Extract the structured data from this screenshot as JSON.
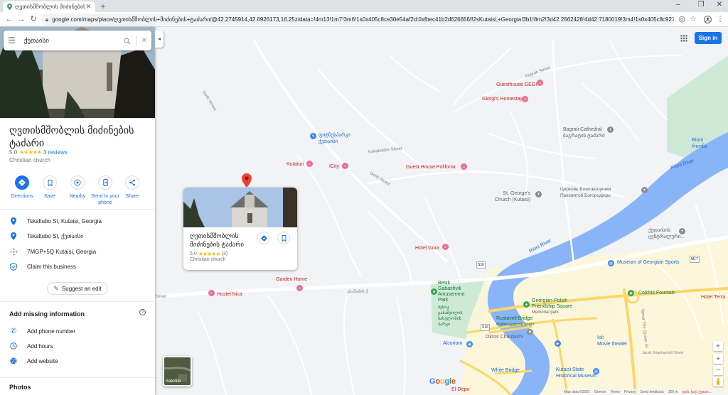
{
  "browser": {
    "tab_title": "ღვთისმშობლის მიძინების ტ",
    "url": "google.com/maps/place/ღვთისმშობლის+მიძინების+ტაძარი/@42.2745914,42.6926173,16.25z/data=!4m13!1m7!3m6!1s0x405c8ce30e54af2d:0xfbec41b2d626656f!2sKutaisi,+Georgia!3b1!8m2!3d42.2662428!4d42.7180019!3m4!1s0x405c8c92767280bf:0xdc0"
  },
  "search": {
    "query": "ქუთაისი"
  },
  "place": {
    "title": "ღვთისმშობლის მიძინების ტაძარი",
    "rating": "5.0",
    "stars": "★★★★★",
    "reviews": "3 reviews",
    "type": "Christian church",
    "actions": [
      {
        "label": "Directions",
        "icon": "directions-icon"
      },
      {
        "label": "Save",
        "icon": "bookmark-icon"
      },
      {
        "label": "Nearby",
        "icon": "nearby-icon"
      },
      {
        "label": "Send to your phone",
        "icon": "phone-icon"
      },
      {
        "label": "Share",
        "icon": "share-icon"
      }
    ],
    "details": [
      {
        "text": "Tskaltubo St, Kutaisi, Georgia",
        "icon": "location-pin-icon"
      },
      {
        "text": "Tskaltubo St, ქუთაისი",
        "icon": "location-pin-icon"
      },
      {
        "text": "7MGP+5Q Kutaisi, Georgia",
        "icon": "plus-code-icon"
      },
      {
        "text": "Claim this business",
        "icon": "verified-shield-icon"
      }
    ],
    "suggest_edit": "Suggest an edit",
    "add_missing": {
      "header": "Add missing information",
      "items": [
        {
          "text": "Add phone number",
          "icon": "phone-call-icon"
        },
        {
          "text": "Add hours",
          "icon": "clock-icon"
        },
        {
          "text": "Add website",
          "icon": "globe-icon"
        }
      ]
    },
    "photos_header": "Photos"
  },
  "map": {
    "signin": "Sign in",
    "card": {
      "title": "ღვთისმშობლის მიძინების ტაძარი",
      "rating": "5.0",
      "stars": "★★★★★",
      "reviews": "(3)",
      "type": "Christian church"
    },
    "satellite_label": "Satellite",
    "google_logo": "Google",
    "footer": {
      "data": "Map data ©2021",
      "country": "Greece",
      "terms": "Terms",
      "privacy": "Privacy",
      "feedback": "Send feedback",
      "scale": "100 m",
      "extra": "დის. საქ. ქუთაი..."
    },
    "pois": {
      "guesthouse_gegi": "Guesthouse GEGI",
      "giorgis_homestay": "Giorgi's Homestay",
      "bagrati": "Bagrati Cathedral",
      "bagrati_ka": "ბაგრატის ტაძარი",
      "rioni": "Rioni",
      "rioni_ka": "რიონი",
      "rioni_river": "Rioni River",
      "rioni_river2": "Rioni River",
      "kutaturi": "Kutaturi",
      "icity": "ICity",
      "guesthouse_polifonia": "Guest House Polifonia",
      "school": "ფიტნესპარკი",
      "school2": "ქუთაისი",
      "st_george": "St. George's Church (Kutaisi)",
      "tserkov": "Церковь Благовещения Пресвятой Богородицы",
      "kutaisi_ka": "ქუთაისის",
      "kutaisi_ka2": "ცენტრალური...",
      "hotel_gora": "Hotel Gora",
      "museum_sports": "Museum of Georgian Sports",
      "besik1": "Besik",
      "besik2": "Gabashvili",
      "besik3": "Amusement",
      "besik4": "Park",
      "besik_ka1": "ბესიკ",
      "besik_ka2": "გაბაშვილის",
      "besik_ka3": "სახელობის",
      "besik_ka4": "პარკი",
      "garden_home": "Garden Home",
      "hostel_nica": "Hostel Nica",
      "georgian_polish1": "Georgian-Polish",
      "georgian_polish2": "Friendship Square",
      "memorial": "Memorial park",
      "colchis": "Colchis Fountain",
      "hotel_terra": "Hotel Terra",
      "rustaveli": "Rustaveli Bridge",
      "rustaveli_ka": "რუსთაველის ხიდი",
      "okros_chardakhi": "Okros Chardakhi",
      "alcorium": "Alcorium",
      "ioli": "Ioli",
      "movie_theater": "Movie theater",
      "white_bridge": "White Bridge",
      "kutaisi_state1": "Kutaisi State",
      "kutaisi_state2": "Historical Museum",
      "el_depo": "El-Depo",
      "street_gorki": "Gorki Street",
      "street_gorki2": "Gorki Street",
      "street_tskaltubo": "Tskaltubo Street",
      "street_tamar": "Tamar The Queen St",
      "street_ka": "აბაშიძის ქ",
      "street_left": "Street",
      "street_kakabadze": "Kakabadze Street",
      "street_gabashvili": "Gabashvili Street",
      "street_bagrati": "Bagrati Street",
      "street_chavchavadze": "Chavchavadze Street",
      "street_jacob": "Jacob Gogebashvili Street",
      "badge_s16": "S16",
      "badge_s16b": "S16",
      "badge_m17": "M17"
    }
  }
}
